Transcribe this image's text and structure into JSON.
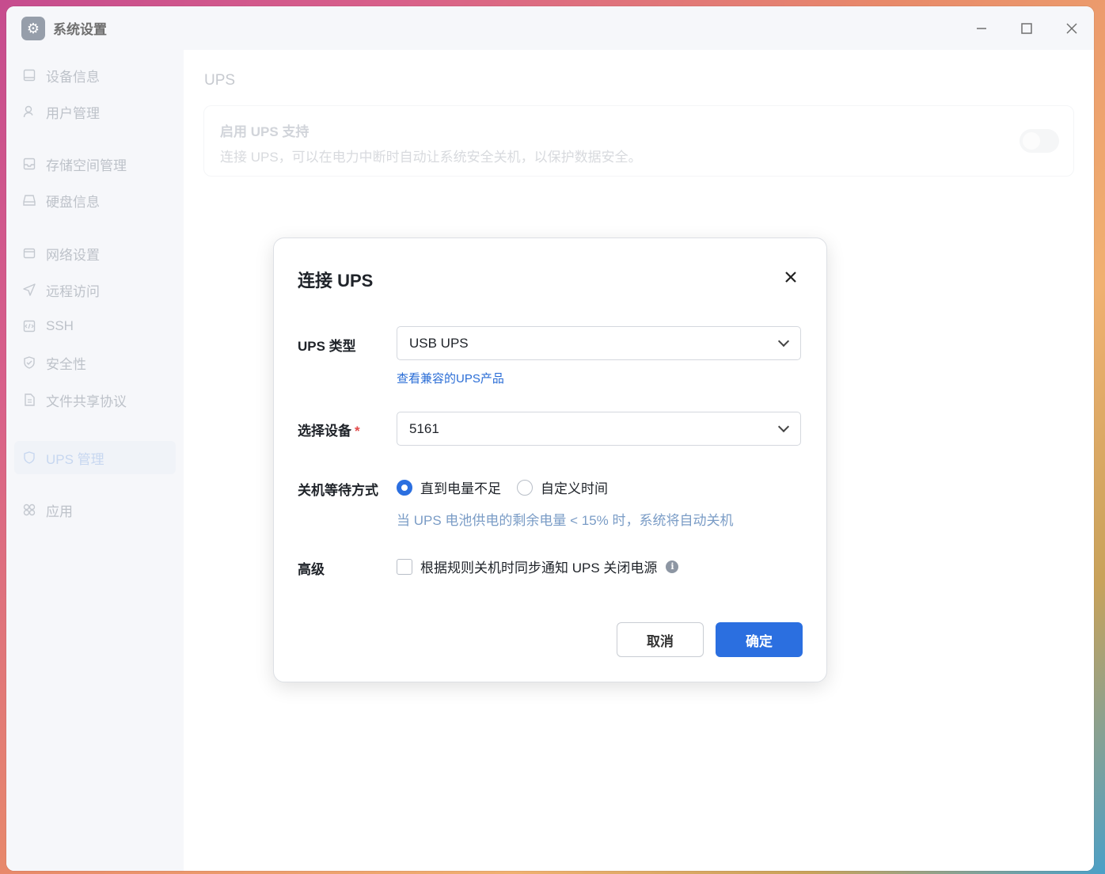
{
  "window": {
    "title": "系统设置",
    "app_icon": "gear-icon",
    "controls": [
      "minimize-icon",
      "maximize-icon",
      "close-icon"
    ]
  },
  "sidebar": {
    "items": [
      {
        "label": "设备信息",
        "icon": "device-icon"
      },
      {
        "label": "用户管理",
        "icon": "user-icon"
      },
      {
        "label": "存储空间管理",
        "icon": "storage-icon"
      },
      {
        "label": "硬盘信息",
        "icon": "disk-icon"
      },
      {
        "label": "网络设置",
        "icon": "network-icon"
      },
      {
        "label": "远程访问",
        "icon": "send-icon"
      },
      {
        "label": "SSH",
        "icon": "code-icon"
      },
      {
        "label": "安全性",
        "icon": "shield-check-icon"
      },
      {
        "label": "文件共享协议",
        "icon": "file-icon"
      },
      {
        "label": "UPS 管理",
        "icon": "shield-icon",
        "active": true
      },
      {
        "label": "应用",
        "icon": "apps-icon"
      }
    ]
  },
  "main": {
    "title": "UPS",
    "card": {
      "title": "启用 UPS 支持",
      "desc": "连接 UPS，可以在电力中断时自动让系统安全关机，以保护数据安全。",
      "toggle_on": false
    }
  },
  "dialog": {
    "title": "连接 UPS",
    "ups_type_label": "UPS 类型",
    "ups_type_value": "USB UPS",
    "compat_link": "查看兼容的UPS产品",
    "device_label": "选择设备",
    "required_mark": "*",
    "device_value": "5161",
    "shutdown_label": "关机等待方式",
    "radio_options": [
      {
        "label": "直到电量不足",
        "selected": true
      },
      {
        "label": "自定义时间",
        "selected": false
      }
    ],
    "shutdown_hint": "当 UPS 电池供电的剩余电量 < 15% 时，系统将自动关机",
    "advanced_label": "高级",
    "advanced_checkbox": "根据规则关机时同步通知 UPS 关闭电源",
    "advanced_checked": false,
    "cancel": "取消",
    "confirm": "确定"
  },
  "colors": {
    "accent": "#2b6fe0",
    "link": "#2a6dd6",
    "hint": "#7a9cc6",
    "sidebar_bg": "#f2f3f7"
  }
}
